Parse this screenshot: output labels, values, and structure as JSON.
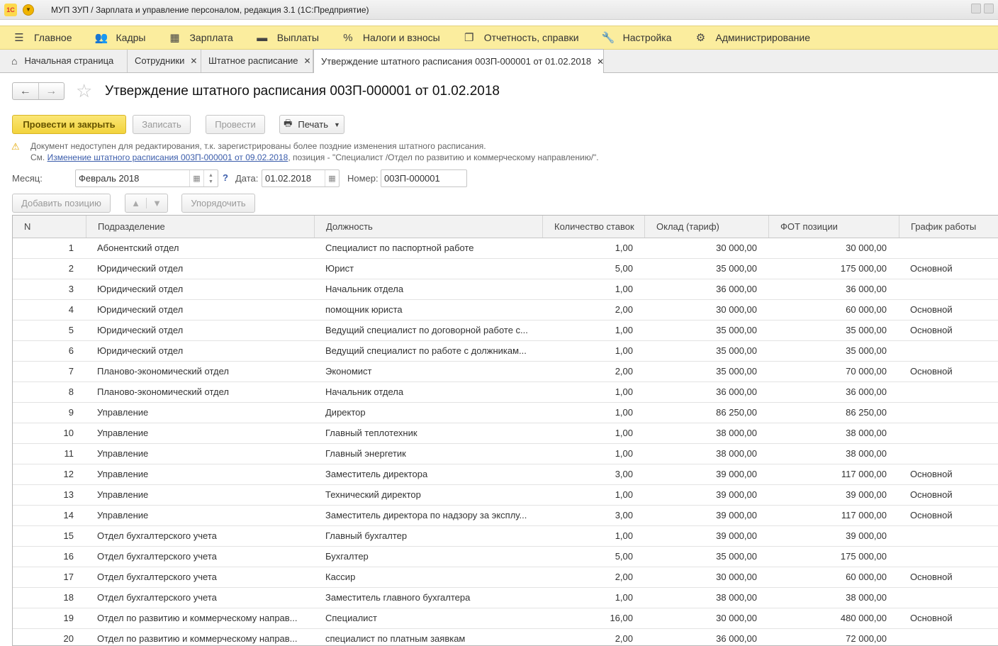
{
  "window": {
    "title": "МУП ЗУП / Зарплата и управление персоналом, редакция 3.1  (1С:Предприятие)",
    "logo_text": "1С"
  },
  "sections": [
    {
      "label": "Главное",
      "icon": "menu-icon"
    },
    {
      "label": "Кадры",
      "icon": "people-icon"
    },
    {
      "label": "Зарплата",
      "icon": "calculator-icon"
    },
    {
      "label": "Выплаты",
      "icon": "wallet-icon"
    },
    {
      "label": "Налоги и взносы",
      "icon": "percent-icon"
    },
    {
      "label": "Отчетность, справки",
      "icon": "reports-icon"
    },
    {
      "label": "Настройка",
      "icon": "wrench-icon"
    },
    {
      "label": "Администрирование",
      "icon": "gear-icon"
    }
  ],
  "tabs": {
    "home": "Начальная страница",
    "employees": "Сотрудники",
    "staffing": "Штатное расписание",
    "current": "Утверждение штатного расписания 003П-000001 от 01.02.2018"
  },
  "document": {
    "title": "Утверждение штатного расписания 003П-000001 от 01.02.2018"
  },
  "commands": {
    "post_close": "Провести и закрыть",
    "save": "Записать",
    "post": "Провести",
    "print": "Печать",
    "add_position": "Добавить позицию",
    "sort": "Упорядочить"
  },
  "warning": {
    "line1": "Документ недоступен для редактирования, т.к. зарегистрированы более поздние изменения штатного расписания.",
    "prefix": "См. ",
    "link": "Изменение штатного расписания 003П-000001 от 09.02.2018",
    "suffix": ", позиция - \"Специалист /Отдел по развитию и коммерческому направлению/\"."
  },
  "fields": {
    "month_label": "Месяц:",
    "month_value": "Февраль 2018",
    "help": "?",
    "date_label": "Дата:",
    "date_value": "01.02.2018",
    "number_label": "Номер:",
    "number_value": "003П-000001"
  },
  "table": {
    "columns": {
      "n": "N",
      "dept": "Подразделение",
      "position": "Должность",
      "rates": "Количество ставок",
      "salary": "Оклад (тариф)",
      "fot": "ФОТ  позиции",
      "schedule": "График работы"
    },
    "rows": [
      {
        "n": "1",
        "dept": "Абонентский отдел",
        "position": "Специалист по паспортной работе",
        "rates": "1,00",
        "salary": "30 000,00",
        "fot": "30 000,00",
        "schedule": ""
      },
      {
        "n": "2",
        "dept": "Юридический отдел",
        "position": "Юрист",
        "rates": "5,00",
        "salary": "35 000,00",
        "fot": "175 000,00",
        "schedule": "Основной"
      },
      {
        "n": "3",
        "dept": "Юридический отдел",
        "position": "Начальник отдела",
        "rates": "1,00",
        "salary": "36 000,00",
        "fot": "36 000,00",
        "schedule": ""
      },
      {
        "n": "4",
        "dept": "Юридический отдел",
        "position": "помощник юриста",
        "rates": "2,00",
        "salary": "30 000,00",
        "fot": "60 000,00",
        "schedule": "Основной"
      },
      {
        "n": "5",
        "dept": "Юридический отдел",
        "position": "Ведущий специалист по договорной работе с...",
        "rates": "1,00",
        "salary": "35 000,00",
        "fot": "35 000,00",
        "schedule": "Основной"
      },
      {
        "n": "6",
        "dept": "Юридический отдел",
        "position": "Ведущий специалист по работе с должникам...",
        "rates": "1,00",
        "salary": "35 000,00",
        "fot": "35 000,00",
        "schedule": ""
      },
      {
        "n": "7",
        "dept": "Планово-экономический отдел",
        "position": "Экономист",
        "rates": "2,00",
        "salary": "35 000,00",
        "fot": "70 000,00",
        "schedule": "Основной"
      },
      {
        "n": "8",
        "dept": "Планово-экономический отдел",
        "position": "Начальник отдела",
        "rates": "1,00",
        "salary": "36 000,00",
        "fot": "36 000,00",
        "schedule": ""
      },
      {
        "n": "9",
        "dept": "Управление",
        "position": "Директор",
        "rates": "1,00",
        "salary": "86 250,00",
        "fot": "86 250,00",
        "schedule": ""
      },
      {
        "n": "10",
        "dept": "Управление",
        "position": "Главный теплотехник",
        "rates": "1,00",
        "salary": "38 000,00",
        "fot": "38 000,00",
        "schedule": ""
      },
      {
        "n": "11",
        "dept": "Управление",
        "position": "Главный энергетик",
        "rates": "1,00",
        "salary": "38 000,00",
        "fot": "38 000,00",
        "schedule": ""
      },
      {
        "n": "12",
        "dept": "Управление",
        "position": "Заместитель директора",
        "rates": "3,00",
        "salary": "39 000,00",
        "fot": "117 000,00",
        "schedule": "Основной"
      },
      {
        "n": "13",
        "dept": "Управление",
        "position": "Технический директор",
        "rates": "1,00",
        "salary": "39 000,00",
        "fot": "39 000,00",
        "schedule": "Основной"
      },
      {
        "n": "14",
        "dept": "Управление",
        "position": "Заместитель директора по надзору за эксплу...",
        "rates": "3,00",
        "salary": "39 000,00",
        "fot": "117 000,00",
        "schedule": "Основной"
      },
      {
        "n": "15",
        "dept": "Отдел бухгалтерского учета",
        "position": "Главный бухгалтер",
        "rates": "1,00",
        "salary": "39 000,00",
        "fot": "39 000,00",
        "schedule": ""
      },
      {
        "n": "16",
        "dept": "Отдел бухгалтерского учета",
        "position": "Бухгалтер",
        "rates": "5,00",
        "salary": "35 000,00",
        "fot": "175 000,00",
        "schedule": ""
      },
      {
        "n": "17",
        "dept": "Отдел бухгалтерского учета",
        "position": "Кассир",
        "rates": "2,00",
        "salary": "30 000,00",
        "fot": "60 000,00",
        "schedule": "Основной"
      },
      {
        "n": "18",
        "dept": "Отдел бухгалтерского учета",
        "position": "Заместитель главного бухгалтера",
        "rates": "1,00",
        "salary": "38 000,00",
        "fot": "38 000,00",
        "schedule": ""
      },
      {
        "n": "19",
        "dept": "Отдел по развитию и коммерческому направ...",
        "position": "Специалист",
        "rates": "16,00",
        "salary": "30 000,00",
        "fot": "480 000,00",
        "schedule": "Основной"
      },
      {
        "n": "20",
        "dept": "Отдел по развитию и коммерческому направ...",
        "position": "специалист по платным заявкам",
        "rates": "2,00",
        "salary": "36 000,00",
        "fot": "72 000,00",
        "schedule": ""
      }
    ]
  }
}
